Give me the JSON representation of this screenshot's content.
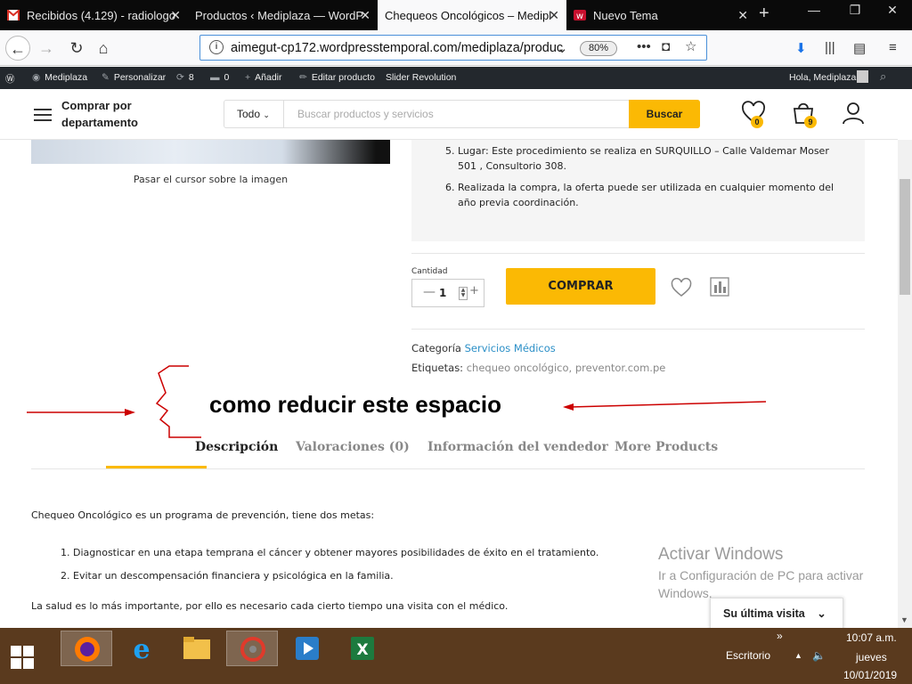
{
  "browser": {
    "tabs": [
      {
        "label": "Recibidos (4.129) - radiologo",
        "icon": "gmail-icon"
      },
      {
        "label": "Productos ‹ Mediplaza — WordP",
        "icon": "wordpress-icon"
      },
      {
        "label": "Chequeos Oncológicos – Medipl",
        "icon": "site-icon",
        "active": true
      },
      {
        "label": "Nuevo Tema",
        "icon": "forum-icon"
      }
    ],
    "url": "aimegut-cp172.wordpresstemporal.com/mediplaza/produc",
    "zoom": "80%"
  },
  "wp_admin_bar": {
    "site": "Mediplaza",
    "customize": "Personalizar",
    "updates": "8",
    "comments": "0",
    "add_new": "Añadir",
    "edit_product": "Editar producto",
    "slider": "Slider Revolution",
    "greeting": "Hola, Mediplaza"
  },
  "header": {
    "department_label": "Comprar por departamento",
    "department_line1": "Comprar por",
    "department_line2": "departamento",
    "category_select": "Todo",
    "search_placeholder": "Buscar productos y servicios",
    "search_button": "Buscar",
    "wishlist_count": "0",
    "cart_count": "9"
  },
  "product": {
    "image_caption": "Pasar el cursor sobre la imagen",
    "details": [
      {
        "num": "5.",
        "text": "Lugar: Este procedimiento se realiza en SURQUILLO – Calle Valdemar Moser 501 , Consultorio 308."
      },
      {
        "num": "6.",
        "text": "Realizada la compra, la oferta puede ser utilizada en cualquier momento del año previa coordinación."
      }
    ],
    "quantity_label": "Cantidad",
    "quantity": "1",
    "buy_button": "COMPRAR",
    "category_label": "Categoría",
    "category": "Servicios Médicos",
    "tags_label": "Etiquetas:",
    "tags": "chequeo oncológico, preventor.com.pe"
  },
  "annotation": {
    "text": "como reducir este espacio"
  },
  "tabs": [
    {
      "label": "Descripción",
      "active": true
    },
    {
      "label": "Valoraciones (0)"
    },
    {
      "label": "Información del vendedor"
    },
    {
      "label": "More Products"
    }
  ],
  "description": {
    "intro": "Chequeo Oncológico es un programa de prevención, tiene dos metas:",
    "goals": [
      "Diagnosticar en una etapa temprana el cáncer y obtener mayores posibilidades de éxito en el tratamiento.",
      "Evitar un descompensación financiera y psicológica en la  familia."
    ],
    "closing": "La salud es lo más importante, por ello es necesario cada cierto tiempo una visita con el médico."
  },
  "windows": {
    "activate_title": "Activar Windows",
    "activate_sub": "Ir a Configuración de PC para activar Windows.",
    "recent_widget": "Su última visita",
    "desktop_label": "Escritorio",
    "time": "10:07 a.m.",
    "day": "jueves",
    "date": "10/01/2019"
  },
  "colors": {
    "accent": "#fbb904",
    "link": "#2b8fc7",
    "wp_bar": "#23282d",
    "annotation": "#cc0000"
  }
}
